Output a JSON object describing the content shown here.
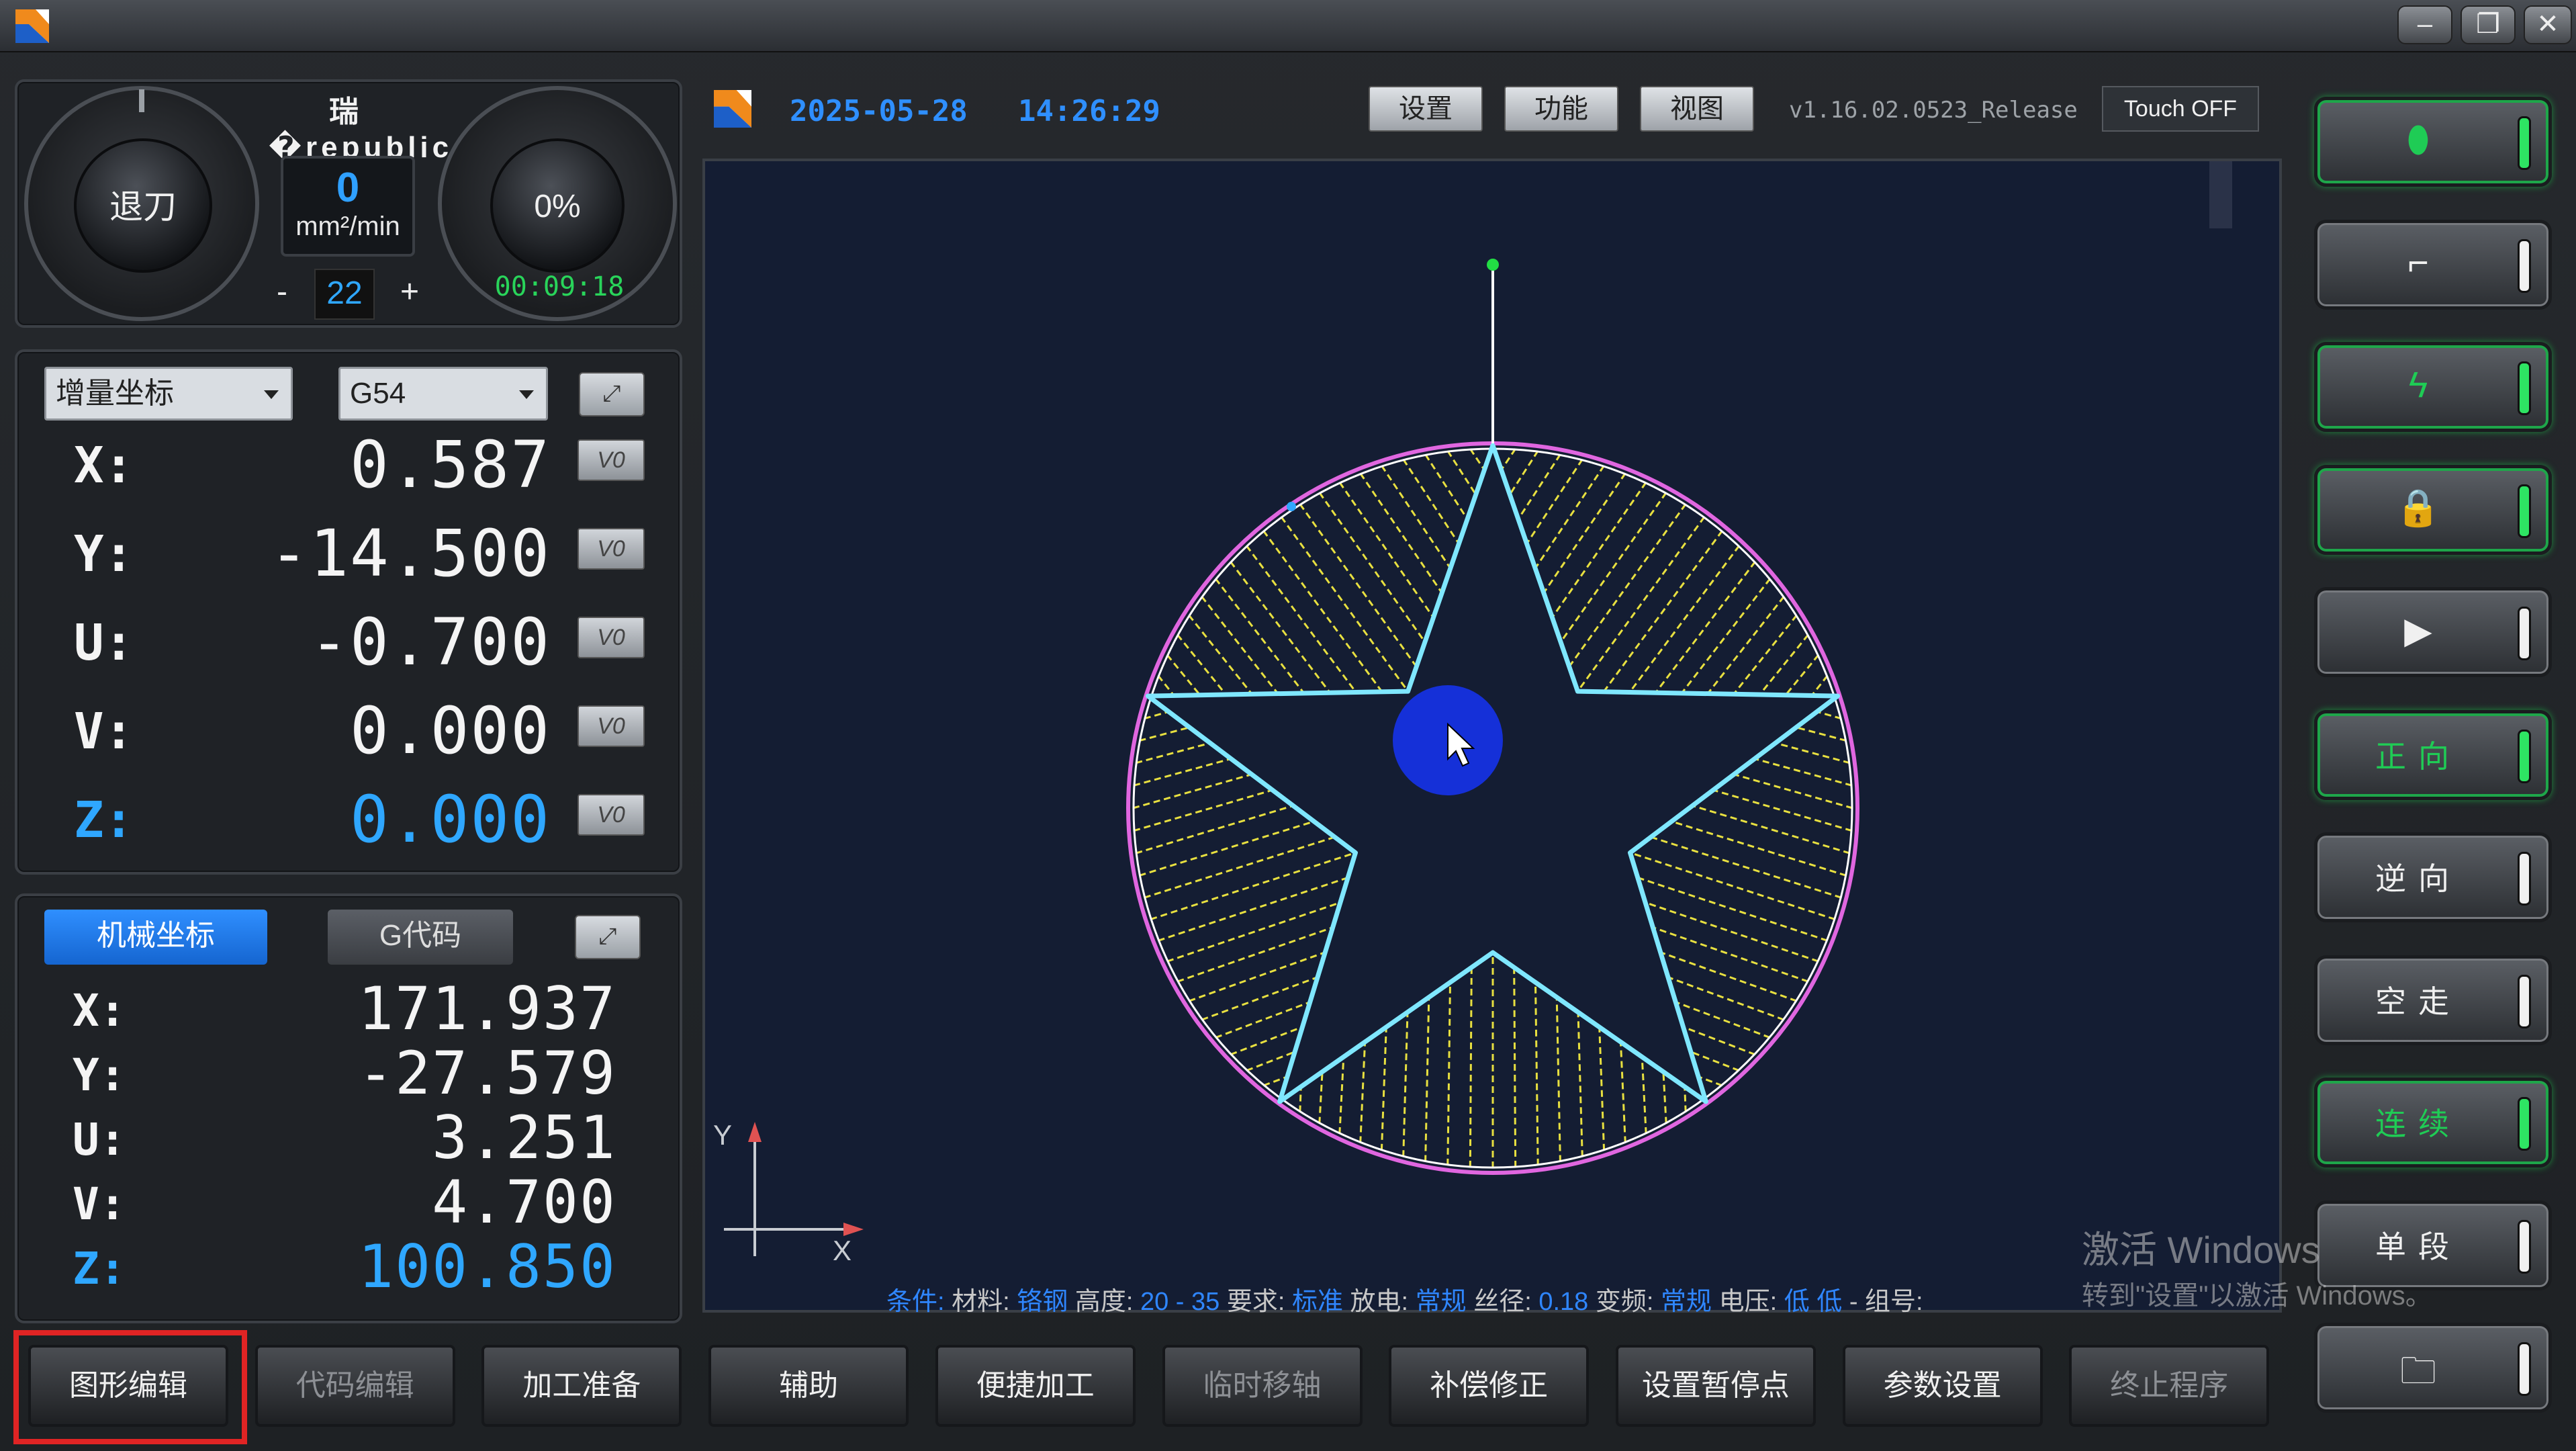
{
  "header": {
    "brand": "瑞�republic科技",
    "date": "2025-05-28",
    "time": "14:26:29",
    "menu": [
      "设置",
      "功能",
      "视图"
    ],
    "version": "v1.16.02.0523_Release",
    "touch": "Touch OFF"
  },
  "dials": {
    "left_knob": "退刀",
    "speed_value": "0",
    "speed_unit": "mm²/min",
    "step_minus": "-",
    "step_value": "22",
    "step_plus": "+",
    "right_knob": "0%",
    "timer": "00:09:18"
  },
  "coords": {
    "mode": "增量坐标",
    "wcs": "G54",
    "zero_label": "V0",
    "axes": [
      {
        "label": "X:",
        "value": "0.587"
      },
      {
        "label": "Y:",
        "value": "-14.500"
      },
      {
        "label": "U:",
        "value": "-0.700"
      },
      {
        "label": "V:",
        "value": "0.000"
      },
      {
        "label": "Z:",
        "value": "0.000"
      }
    ]
  },
  "machine": {
    "tab_active": "机械坐标",
    "tab_other": "G代码",
    "axes": [
      {
        "label": "X:",
        "value": "171.937"
      },
      {
        "label": "Y:",
        "value": "-27.579"
      },
      {
        "label": "U:",
        "value": "3.251"
      },
      {
        "label": "V:",
        "value": "4.700"
      },
      {
        "label": "Z:",
        "value": "100.850"
      }
    ]
  },
  "canvas": {
    "axis_y": "Y",
    "axis_x": "X"
  },
  "status": {
    "p1": "条件:",
    "p2": "材料:",
    "v2": "铬钢",
    "p3": "高度:",
    "v3": "20 - 35",
    "p4": "要求:",
    "v4": "标准",
    "p5": "放电:",
    "v5": "常规",
    "p6": "丝径:",
    "v6": "0.18",
    "p7": "变频:",
    "v7": "常规",
    "p8": "电压:",
    "v8": "低 低",
    "p9": "- 组号:"
  },
  "side_buttons": [
    {
      "label": "",
      "icon": "pump-icon",
      "active": true
    },
    {
      "label": "",
      "icon": "faucet-icon",
      "active": false
    },
    {
      "label": "",
      "icon": "lightning-icon",
      "active": true
    },
    {
      "label": "",
      "icon": "lock-icon",
      "active": true
    },
    {
      "label": "",
      "icon": "play-icon",
      "active": false
    },
    {
      "label": "正向",
      "icon": "",
      "active": true
    },
    {
      "label": "逆向",
      "icon": "",
      "active": false
    },
    {
      "label": "空走",
      "icon": "",
      "active": false
    },
    {
      "label": "连续",
      "icon": "",
      "active": true
    },
    {
      "label": "单段",
      "icon": "",
      "active": false
    },
    {
      "label": "",
      "icon": "folder-icon",
      "active": false
    }
  ],
  "bottom_buttons": [
    "图形编辑",
    "代码编辑",
    "加工准备",
    "辅助",
    "便捷加工",
    "临时移轴",
    "补偿修正",
    "设置暂停点",
    "参数设置",
    "终止程序"
  ],
  "watermark": {
    "line1": "激活 Windows",
    "line2": "转到\"设置\"以激活 Windows。"
  },
  "colors": {
    "accent_blue": "#2fa7ff",
    "active_green": "#1fcc55",
    "star_line": "#7fe7ff",
    "circle_line": "#e066e0",
    "hatch": "#e8e040",
    "cursor_blob": "#1530d8"
  }
}
